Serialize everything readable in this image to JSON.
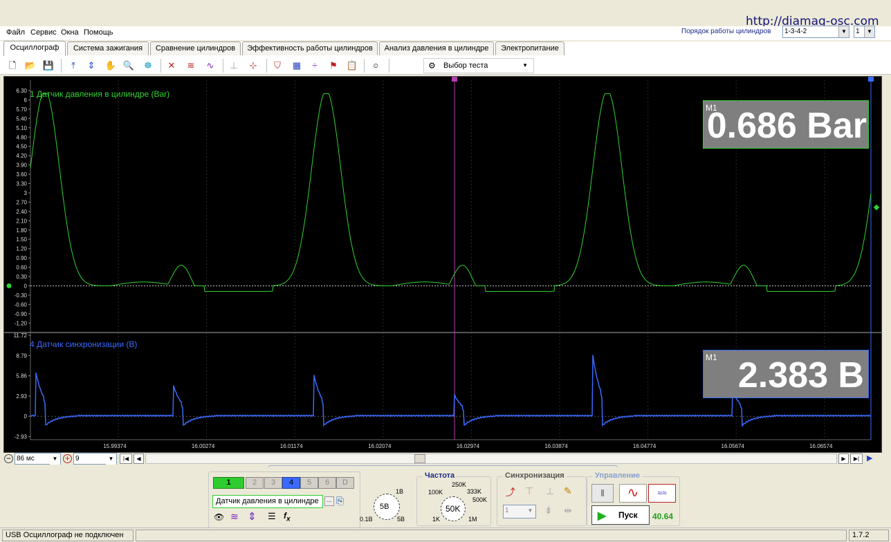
{
  "watermark": "http://diamag-osc.com",
  "menu": [
    "Файл",
    "Сервис",
    "Окна",
    "Помощь"
  ],
  "cylinder_order": {
    "label": "Порядок работы цилиндров",
    "value": "1-3-4-2",
    "cyl": "1"
  },
  "tabs": [
    "Осциллограф",
    "Система зажигания",
    "Сравнение цилиндров",
    "Эффективность работы цилиндров",
    "Анализ давления в цилиндре",
    "Электропитание"
  ],
  "active_tab": 0,
  "toolbar": {
    "test_select": "Выбор теста",
    "icons": [
      "new-icon",
      "open-icon",
      "save-icon",
      "cursor-horizontal-icon",
      "cursor-vertical-icon",
      "hand-icon",
      "zoom-icon",
      "filter-icon",
      "xy-icon",
      "overlay-icon",
      "spectrum-icon",
      "auto-trigger-icon",
      "zero-icon",
      "channel-config-icon",
      "table-icon",
      "level-icon",
      "marker-icon",
      "notes-icon",
      "auto-icon"
    ]
  },
  "channel1": {
    "label": "1 Датчик давления в цилиндре (Bar)",
    "color": "#2fd42f",
    "marker": "M1",
    "readout": "0.686 Bar",
    "y_ticks": [
      "6.30",
      "6",
      "5.70",
      "5.40",
      "5.10",
      "4.80",
      "4.50",
      "4.20",
      "3.90",
      "3.60",
      "3.30",
      "3",
      "2.70",
      "2.40",
      "2.10",
      "1.80",
      "1.50",
      "1.20",
      "0.90",
      "0.60",
      "0.30",
      "0",
      "-0.30",
      "-0.60",
      "-0.90",
      "-1.20"
    ]
  },
  "channel4": {
    "label": "4 Датчик синхронизации (В)",
    "color": "#3a6aff",
    "marker": "M1",
    "readout": "2.383 В",
    "y_ticks": [
      "11.72",
      "8.79",
      "5.86",
      "2.93",
      "0",
      "-2.93"
    ]
  },
  "x_ticks": [
    "15.99374",
    "16.00274",
    "16.01174",
    "16.02074",
    "16.02974",
    "16.03874",
    "16.04774",
    "16.05674",
    "16.06574"
  ],
  "timebase": {
    "value": "86 мс",
    "count": "9"
  },
  "channels": {
    "buttons": [
      "1",
      "2",
      "3",
      "4",
      "5",
      "6",
      "D"
    ],
    "active": [
      "1",
      "4"
    ],
    "name": "Датчик давления в цилиндре",
    "knob": {
      "center": "5В",
      "min": "0.1В",
      "top": "1В",
      "max": "5В"
    }
  },
  "frequency": {
    "title": "Частота",
    "center": "50K",
    "labels": [
      "100K",
      "250K",
      "333K",
      "500K",
      "1K",
      "1M"
    ]
  },
  "sync": {
    "title": "Синхронизация",
    "channel": "1"
  },
  "control": {
    "title": "Управление",
    "start": "Пуск",
    "value": "40.64"
  },
  "status": {
    "left": "USB Осциллограф не подключен",
    "version": "1.7.2"
  }
}
